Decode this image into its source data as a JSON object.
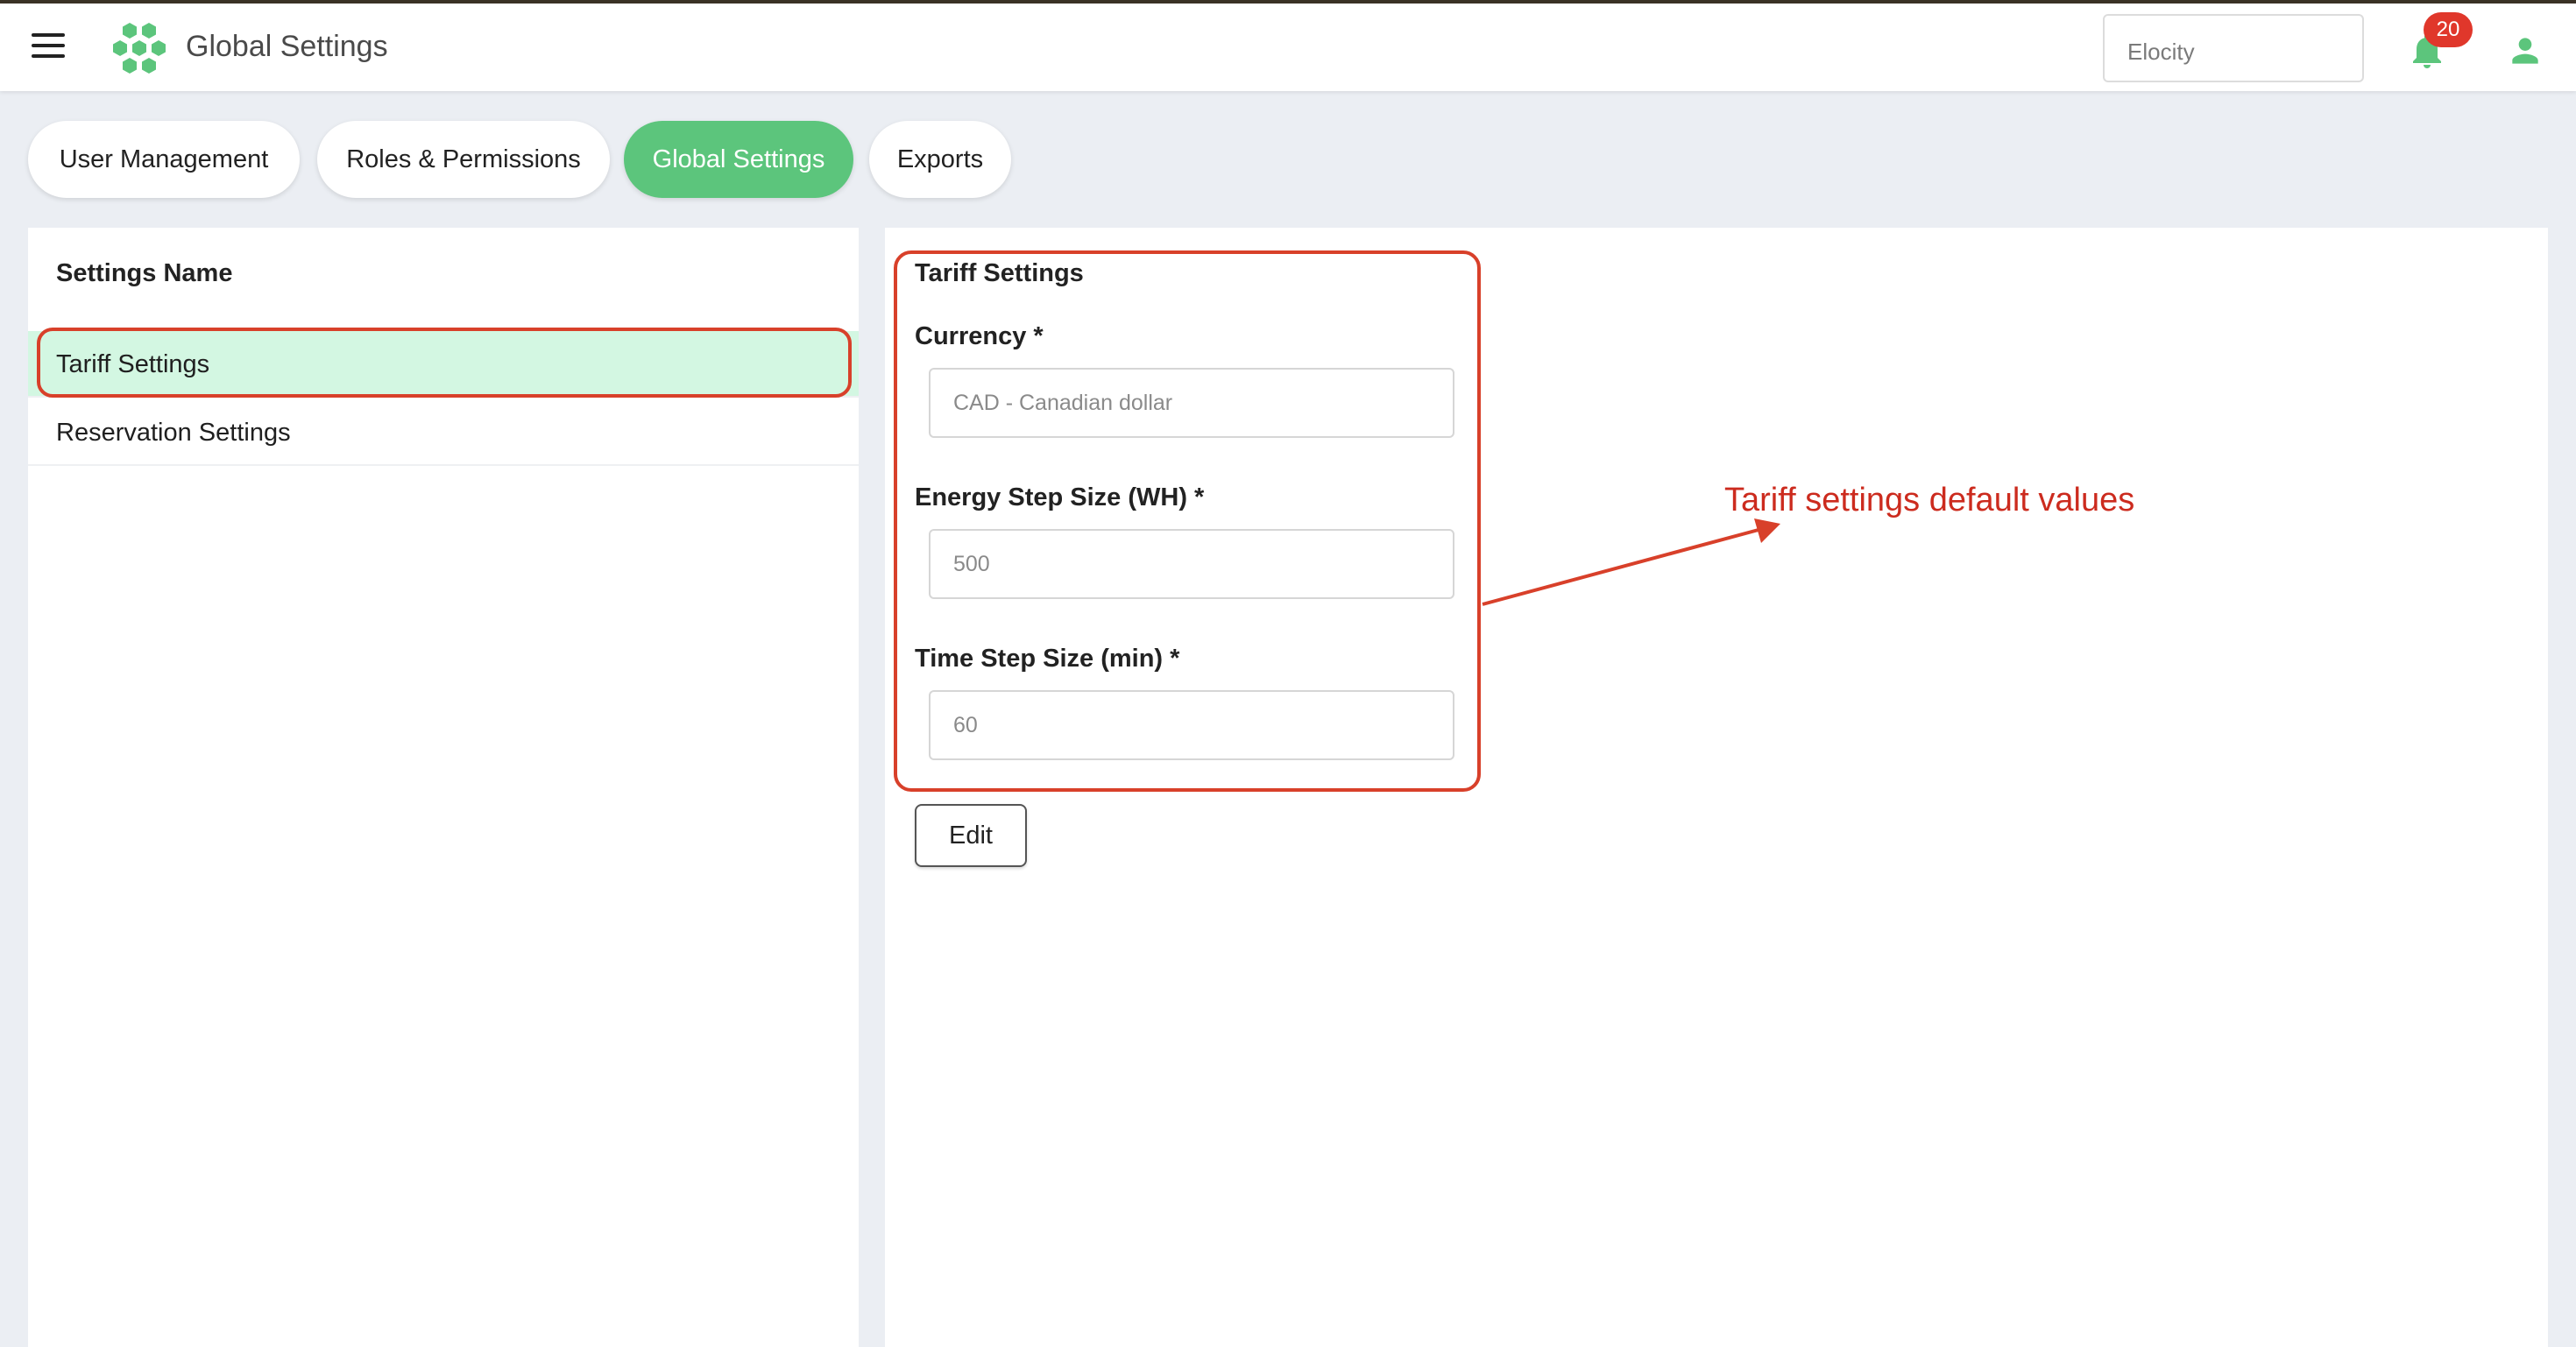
{
  "header": {
    "app_title": "Global Settings",
    "org_select_value": "Elocity",
    "notification_count": "20",
    "brand_color": "#5cc57c",
    "icons": [
      "menu-icon",
      "hexagon-logo-icon",
      "bell-icon",
      "user-icon"
    ]
  },
  "tabs": [
    {
      "label": "User Management",
      "active": false
    },
    {
      "label": "Roles & Permissions",
      "active": false
    },
    {
      "label": "Global Settings",
      "active": true
    },
    {
      "label": "Exports",
      "active": false
    }
  ],
  "left_panel": {
    "heading": "Settings Name",
    "items": [
      {
        "label": "Tariff Settings",
        "selected": true
      },
      {
        "label": "Reservation Settings",
        "selected": false
      }
    ]
  },
  "tariff_form": {
    "title": "Tariff Settings",
    "currency_label": "Currency *",
    "currency_value": "CAD - Canadian dollar",
    "energy_label": "Energy Step Size (WH) *",
    "energy_value": "500",
    "time_label": "Time Step Size (min) *",
    "time_value": "60",
    "edit_label": "Edit"
  },
  "annotation": {
    "text": "Tariff settings default values",
    "color": "#d8402a"
  }
}
